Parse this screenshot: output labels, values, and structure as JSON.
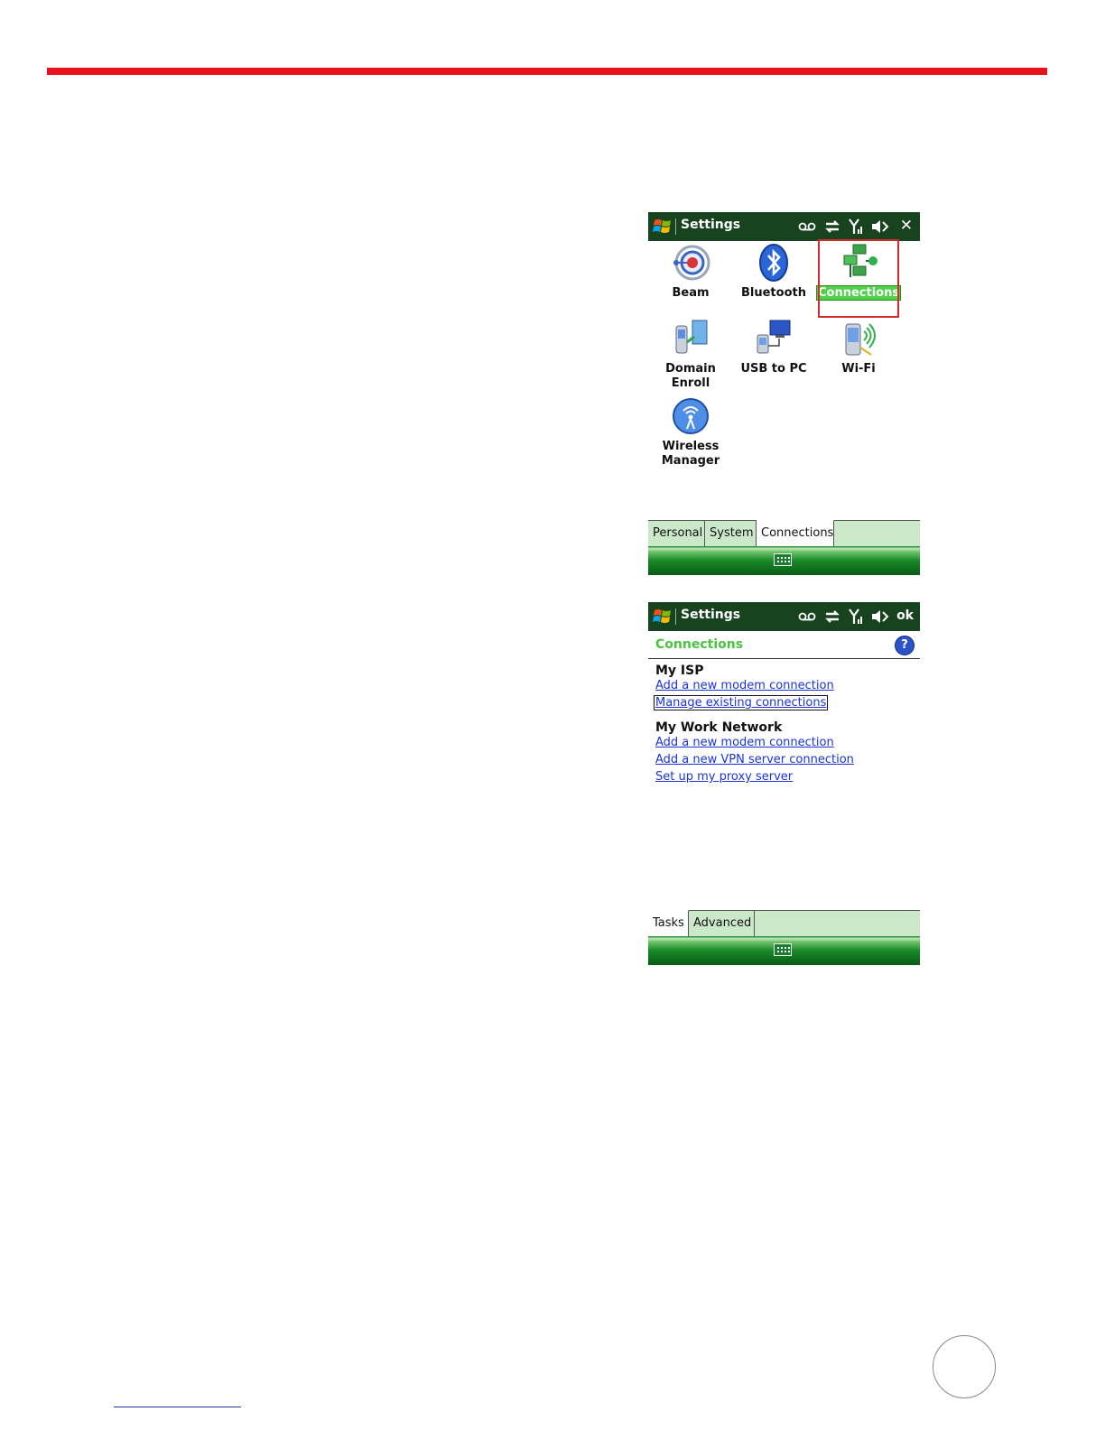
{
  "screen1": {
    "title": "Settings",
    "items": [
      {
        "label": "Beam"
      },
      {
        "label": "Bluetooth"
      },
      {
        "label": "Connections"
      },
      {
        "label": "Domain\nEnroll"
      },
      {
        "label": "USB to PC"
      },
      {
        "label": "Wi-Fi"
      },
      {
        "label": "Wireless\nManager"
      }
    ],
    "tabs": [
      "Personal",
      "System",
      "Connections"
    ]
  },
  "screen2": {
    "title": "Settings",
    "ok_label": "ok",
    "section_title": "Connections",
    "help_label": "?",
    "groups": [
      {
        "title": "My ISP",
        "links": [
          "Add a new modem connection",
          "Manage existing connections"
        ]
      },
      {
        "title": "My Work Network",
        "links": [
          "Add a new modem connection",
          "Add a new VPN server connection",
          "Set up my proxy server"
        ]
      }
    ],
    "tabs": [
      "Tasks",
      "Advanced"
    ]
  },
  "colors": {
    "accent_red": "#e8121c",
    "titlebar": "#17431f",
    "link": "#1a34d8",
    "section_green": "#4ac43f"
  }
}
